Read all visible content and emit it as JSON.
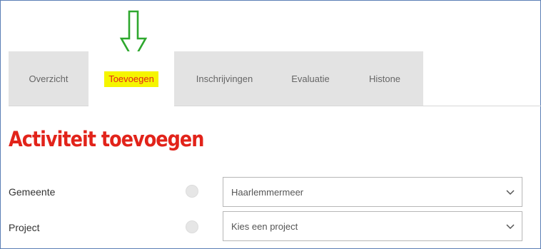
{
  "tabs": [
    {
      "label": "Overzicht",
      "active": false
    },
    {
      "label": "Toevoegen",
      "active": true
    },
    {
      "label": "Inschrijvingen",
      "active": false
    },
    {
      "label": "Evaluatie",
      "active": false
    },
    {
      "label": "Histone",
      "active": false
    }
  ],
  "page_title": "Activiteit toevoegen",
  "form": {
    "gemeente": {
      "label": "Gemeente",
      "value": "Haarlemmermeer",
      "icon": "info-icon"
    },
    "project": {
      "label": "Project",
      "value": "Kies een project",
      "icon": "info-icon"
    }
  },
  "annotation": {
    "icon": "down-arrow-icon",
    "color": "#2ea82e"
  },
  "colors": {
    "accent_red": "#e2231a",
    "highlight_yellow": "#f5f500",
    "tab_gray": "#e3e3e3"
  }
}
